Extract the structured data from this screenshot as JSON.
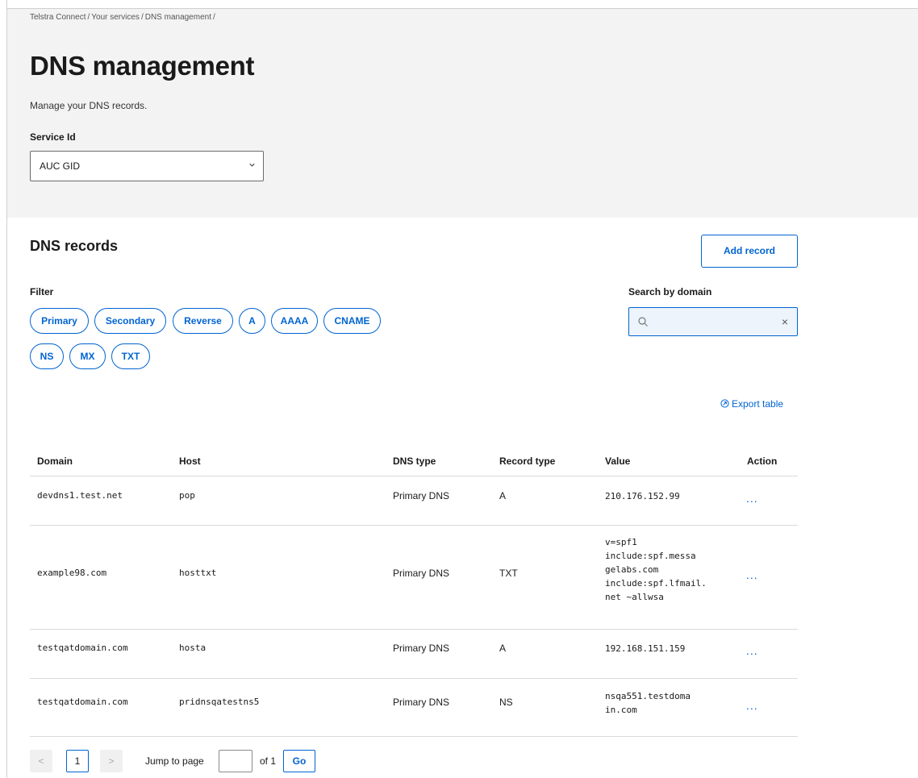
{
  "breadcrumb": [
    "Telstra Connect",
    "Your services",
    "DNS management"
  ],
  "breadcrumb_sep": "/",
  "header": {
    "title": "DNS management",
    "subtitle": "Manage your DNS records.",
    "service_label": "Service Id",
    "service_value": "AUC GID"
  },
  "records": {
    "title": "DNS records",
    "add_label": "Add record",
    "filter_label": "Filter",
    "filters": [
      "Primary",
      "Secondary",
      "Reverse",
      "A",
      "AAAA",
      "CNAME",
      "NS",
      "MX",
      "TXT"
    ],
    "search_label": "Search by domain",
    "search_value": "",
    "clear_icon": "close-icon",
    "export_label": "Export table"
  },
  "table": {
    "columns": [
      "Domain",
      "Host",
      "DNS type",
      "Record type",
      "Value",
      "Action"
    ],
    "rows": [
      {
        "domain": "devdns1.test.net",
        "host": "pop",
        "dns_type": "Primary DNS",
        "record_type": "A",
        "value": [
          "210.176.152.99"
        ],
        "action": "..."
      },
      {
        "domain": "example98.com",
        "host": "hosttxt",
        "dns_type": "Primary DNS",
        "record_type": "TXT",
        "value": [
          "v=spf1",
          "include:spf.messa",
          "gelabs.com",
          "include:spf.lfmail.",
          "net ~allwsa"
        ],
        "action": "..."
      },
      {
        "domain": "testqatdomain.com",
        "host": "hosta",
        "dns_type": "Primary DNS",
        "record_type": "A",
        "value": [
          "192.168.151.159"
        ],
        "action": "..."
      },
      {
        "domain": "testqatdomain.com",
        "host": "pridnsqatestns5",
        "dns_type": "Primary DNS",
        "record_type": "NS",
        "value": [
          "nsqa551.testdoma",
          "in.com"
        ],
        "action": "..."
      }
    ]
  },
  "pagination": {
    "prev": "<",
    "current": "1",
    "next": ">",
    "jump_label": "Jump to page",
    "jump_value": "",
    "of_label": "of 1",
    "go_label": "Go"
  },
  "colors": {
    "accent": "#0064d2",
    "hero_bg": "#f3f3f3"
  }
}
